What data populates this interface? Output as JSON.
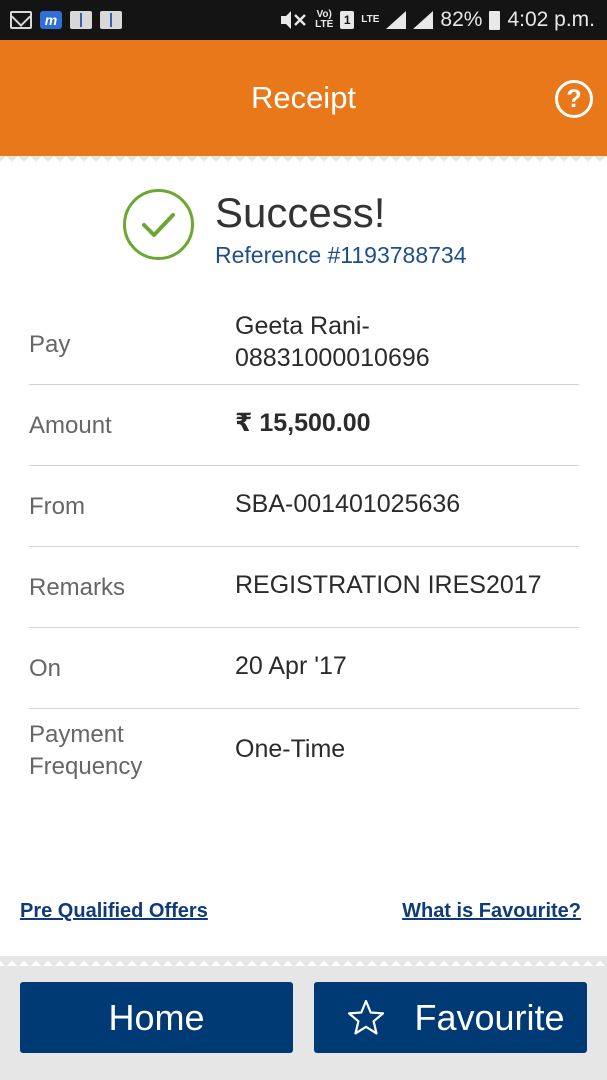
{
  "status_bar": {
    "volte_top": "Vo)",
    "volte_bottom": "LTE",
    "sim": "1",
    "lte": "LTE",
    "battery": "82%",
    "time": "4:02 p.m."
  },
  "header": {
    "title": "Receipt",
    "help_symbol": "?"
  },
  "result": {
    "title": "Success!",
    "reference": "Reference #1193788734"
  },
  "details": {
    "pay_label": "Pay",
    "pay_value_line1": "Geeta Rani-",
    "pay_value_line2": "08831000010696",
    "amount_label": "Amount",
    "amount_value": "₹ 15,500.00",
    "from_label": "From",
    "from_value": "SBA-001401025636",
    "remarks_label": "Remarks",
    "remarks_value": "REGISTRATION IRES2017",
    "on_label": "On",
    "on_value": "20 Apr '17",
    "frequency_label_line1": "Payment",
    "frequency_label_line2": "Frequency",
    "frequency_value": "One-Time"
  },
  "links": {
    "offers": "Pre Qualified Offers",
    "what_is_favourite": "What is Favourite?"
  },
  "footer": {
    "home_label": "Home",
    "favourite_label": "Favourite"
  },
  "colors": {
    "header": "#e8781a",
    "success": "#6aa832",
    "primary_button": "#003a75",
    "link": "#0f3c78"
  },
  "icons": [
    "mail-icon",
    "mobile-banking-app-icon",
    "book-icon",
    "mute-icon",
    "volte-icon",
    "sim-icon",
    "lte-signal-icon",
    "signal-icon",
    "battery-icon",
    "help-icon",
    "check-circle-icon",
    "star-outline-icon"
  ]
}
